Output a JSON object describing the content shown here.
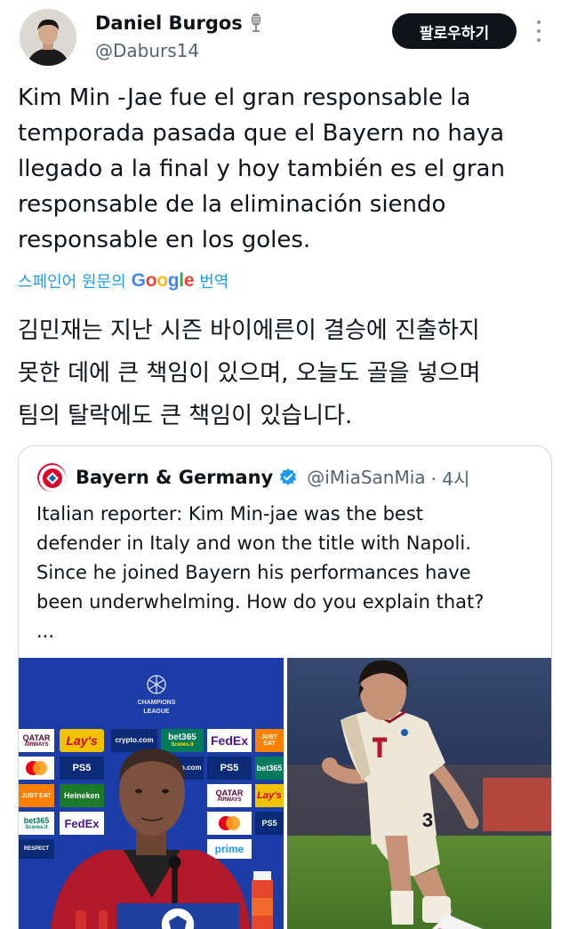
{
  "author": {
    "display_name": "Daniel Burgos",
    "handle": "@Daburs14"
  },
  "follow_label": "팔로우하기",
  "tweet_text": "Kim Min -Jae fue el gran responsable la\ntemporada pasada  que el Bayern no haya\nllegado a la final y hoy también es el gran\nresponsable de la eliminación siendo\nresponsable en los goles.",
  "translate": {
    "prefix": "스페인어 원문의",
    "google": "Google",
    "suffix": "번역"
  },
  "translation_text": "김민재는 지난 시즌 바이에른이 결승에 진출하지\n못한 데에 큰 책임이 있으며, 오늘도 골을 넣으며\n팀의 탈락에도 큰 책임이 있습니다.",
  "quote": {
    "display_name": "Bayern & Germany",
    "handle": "@iMiaSanMia",
    "time": "· 4시",
    "text": "Italian reporter: Kim Min-jae was the best\ndefender in Italy and won the title with Napoli.\nSince he joined Bayern his performances have\nbeen underwhelming. How do you explain that?\n..."
  },
  "media_left": {
    "league_line1": "CHAMPIONS",
    "league_line2": "LEAGUE",
    "sponsors": {
      "qatar": "QATAR",
      "qatar_sub": "AIRWAYS",
      "lays": "Lay's",
      "crypto": "crypto.com",
      "bet365": "bet365",
      "bet365_sub": "Scores.it",
      "fedex": "FedEx",
      "ps5": "PS5",
      "just_eat": "JUST EAT",
      "heineken": "Heineken",
      "respect": "RESPECT",
      "prime": "prime"
    }
  },
  "media_right": {
    "shirt_number": "3"
  },
  "colors": {
    "link_blue": "#1d9bf0",
    "verified_blue": "#1d9bf0",
    "text_primary": "#0f1419",
    "text_secondary": "#536471",
    "ucl_blue": "#1c3da8"
  }
}
